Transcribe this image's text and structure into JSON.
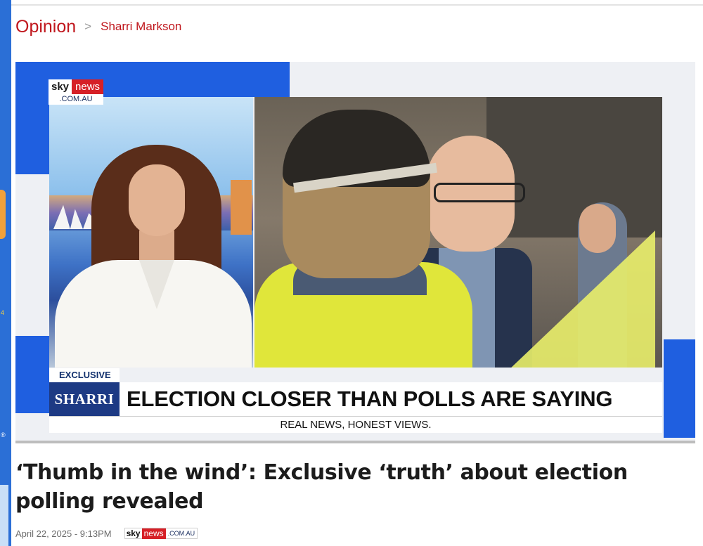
{
  "breadcrumb": {
    "section": "Opinion",
    "separator": ">",
    "author": "Sharri Markson"
  },
  "video": {
    "logo": {
      "sky": "sky",
      "news": "news",
      "domain": ".COM.AU"
    },
    "lower_third": {
      "tag": "EXCLUSIVE",
      "name": "SHARRI",
      "headline": "ELECTION CLOSER THAN POLLS ARE SAYING",
      "strapline": "REAL NEWS, HONEST VIEWS."
    }
  },
  "article": {
    "title": "‘Thumb in the wind’: Exclusive ‘truth’ about election polling revealed",
    "date": "April 22, 2025 - 9:13PM",
    "source_logo": {
      "sky": "sky",
      "news": "news",
      "domain": ".COM.AU"
    }
  },
  "left_strip": {
    "mark": "®",
    "digit": "4"
  },
  "colors": {
    "accent": "#c0171d",
    "brand_red": "#d62027",
    "brand_navy": "#1d3a84"
  }
}
